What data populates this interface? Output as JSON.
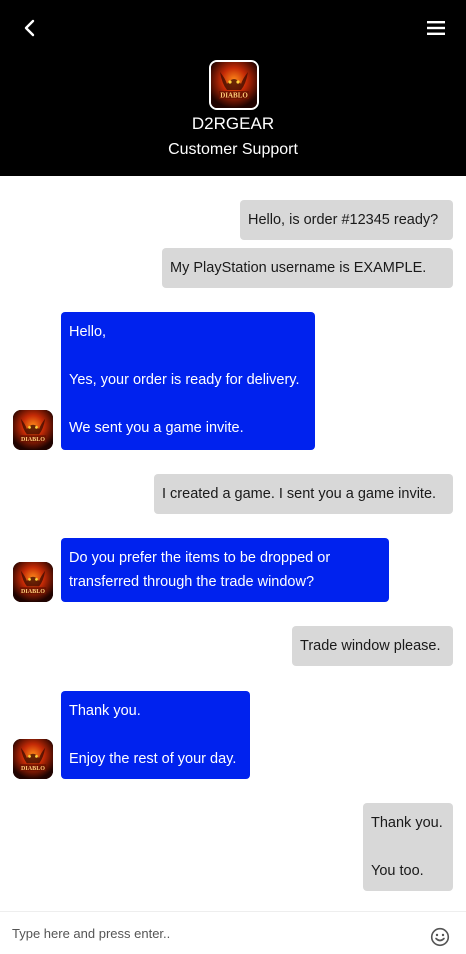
{
  "header": {
    "brand_name": "D2RGEAR",
    "subtitle": "Customer Support",
    "logo_text": "DIABLO"
  },
  "messages": [
    {
      "sender": "user",
      "text": "Hello, is order #12345 ready?"
    },
    {
      "sender": "user",
      "text": "My PlayStation username is EXAMPLE."
    },
    {
      "sender": "agent",
      "text": "Hello,\n\nYes, your order is ready for delivery.\n\nWe sent you a game invite."
    },
    {
      "sender": "user",
      "text": "I created a game. I sent you a game invite."
    },
    {
      "sender": "agent",
      "text": "Do you prefer the items to be dropped or\ntransferred through the trade window?"
    },
    {
      "sender": "user",
      "text": "Trade window please."
    },
    {
      "sender": "agent",
      "text": "Thank you.\n\nEnjoy the rest of your day."
    },
    {
      "sender": "user",
      "text": "Thank you.\n\nYou too."
    }
  ],
  "composer": {
    "placeholder": "Type here and press enter.."
  },
  "colors": {
    "header_bg": "#000000",
    "agent_bubble": "#0022ee",
    "user_bubble": "#d8d8d8"
  }
}
